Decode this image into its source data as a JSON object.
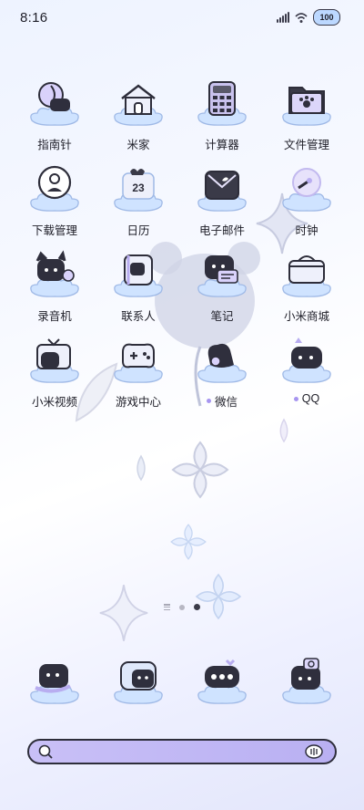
{
  "status": {
    "time": "8:16",
    "battery": "100"
  },
  "apps": [
    {
      "label": "指南针",
      "icon": "compass-icon"
    },
    {
      "label": "米家",
      "icon": "home-icon"
    },
    {
      "label": "计算器",
      "icon": "calculator-icon"
    },
    {
      "label": "文件管理",
      "icon": "folder-icon"
    },
    {
      "label": "下载管理",
      "icon": "download-icon"
    },
    {
      "label": "日历",
      "icon": "calendar-icon",
      "badge": "23"
    },
    {
      "label": "电子邮件",
      "icon": "email-icon"
    },
    {
      "label": "时钟",
      "icon": "clock-icon"
    },
    {
      "label": "录音机",
      "icon": "recorder-icon"
    },
    {
      "label": "联系人",
      "icon": "contacts-icon"
    },
    {
      "label": "笔记",
      "icon": "notes-icon"
    },
    {
      "label": "小米商城",
      "icon": "store-icon"
    },
    {
      "label": "小米视频",
      "icon": "tv-icon"
    },
    {
      "label": "游戏中心",
      "icon": "gamepad-icon"
    },
    {
      "label": "微信",
      "icon": "wechat-icon",
      "dot": true
    },
    {
      "label": "QQ",
      "icon": "qq-icon",
      "dot": true
    }
  ],
  "dock": [
    {
      "icon": "phone-icon"
    },
    {
      "icon": "messages-icon"
    },
    {
      "icon": "chat-icon"
    },
    {
      "icon": "camera-icon"
    }
  ],
  "pager": {
    "pages": 2,
    "active": 1
  },
  "colors": {
    "accent": "#b9b0f2",
    "cloud": "#cfe3ff",
    "ink": "#2d2d3a"
  }
}
